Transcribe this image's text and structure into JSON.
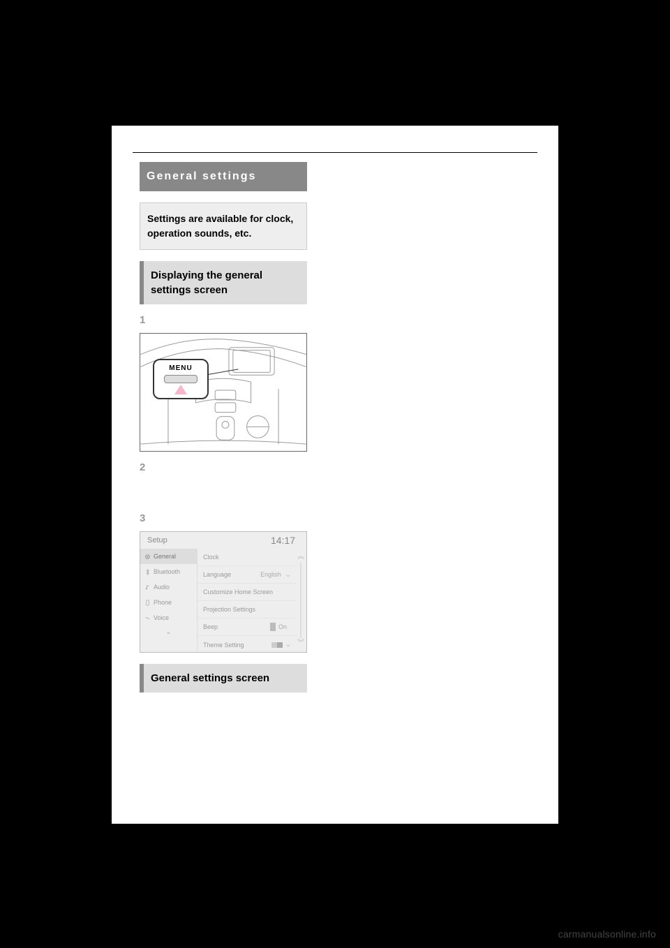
{
  "header": {
    "title": "General settings"
  },
  "intro": "Settings are available for clock, operation sounds, etc.",
  "section1": {
    "heading": "Displaying the general settings screen",
    "steps": {
      "s1_num": "1",
      "s2_num": "2",
      "s3_num": "3"
    },
    "menu_label": "MENU"
  },
  "section2": {
    "heading": "General settings screen"
  },
  "setup_screen": {
    "title": "Setup",
    "time": "14:17",
    "sidebar": {
      "general": "General",
      "bluetooth": "Bluetooth",
      "audio": "Audio",
      "phone": "Phone",
      "voice": "Voice"
    },
    "rows": {
      "clock": {
        "label": "Clock"
      },
      "language": {
        "label": "Language",
        "value": "English"
      },
      "customize": {
        "label": "Customize Home Screen"
      },
      "projection": {
        "label": "Projection Settings"
      },
      "beep": {
        "label": "Beep",
        "value": "On"
      },
      "theme": {
        "label": "Theme Setting"
      }
    }
  },
  "watermark": "carmanualsonline.info"
}
